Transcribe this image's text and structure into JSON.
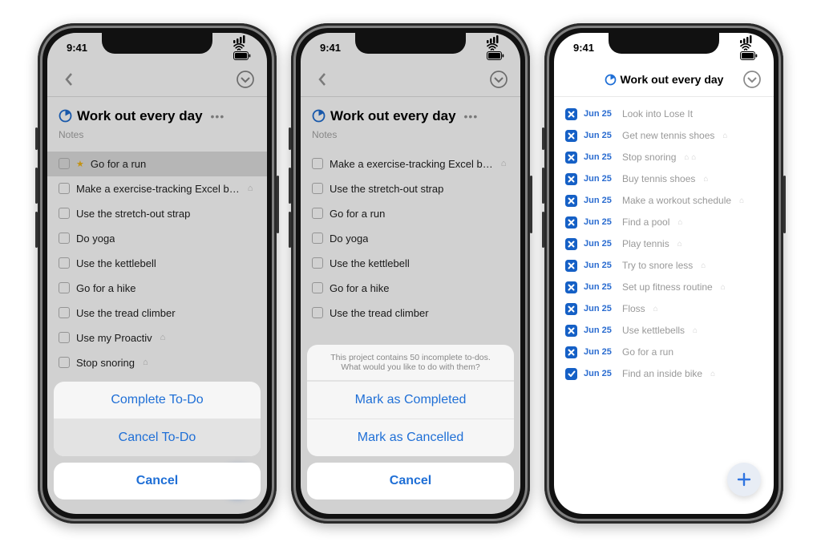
{
  "status": {
    "time": "9:41"
  },
  "phone1": {
    "title": "Work out every day",
    "notes_placeholder": "Notes",
    "todos": [
      {
        "label": "Go for a run",
        "starred": true,
        "selected": true
      },
      {
        "label": "Make a exercise-tracking Excel b…",
        "trail": true
      },
      {
        "label": "Use the stretch-out strap"
      },
      {
        "label": "Do yoga"
      },
      {
        "label": "Use the kettlebell"
      },
      {
        "label": "Go for a hike"
      },
      {
        "label": "Use the tread climber"
      },
      {
        "label": "Use my Proactiv",
        "trail": true
      },
      {
        "label": "Stop snoring",
        "trail": true
      }
    ],
    "sheet": {
      "complete": "Complete To-Do",
      "cancel_todo": "Cancel To-Do",
      "cancel": "Cancel"
    }
  },
  "phone2": {
    "title": "Work out every day",
    "notes_placeholder": "Notes",
    "todos": [
      {
        "label": "Make a exercise-tracking Excel b…",
        "trail": true
      },
      {
        "label": "Use the stretch-out strap"
      },
      {
        "label": "Go for a run"
      },
      {
        "label": "Do yoga"
      },
      {
        "label": "Use the kettlebell"
      },
      {
        "label": "Go for a hike"
      },
      {
        "label": "Use the tread climber"
      }
    ],
    "sheet": {
      "message": "This project contains 50 incomplete to-dos. What would you like to do with them?",
      "completed": "Mark as Completed",
      "cancelled": "Mark as Cancelled",
      "cancel": "Cancel"
    }
  },
  "phone3": {
    "title": "Work out every day",
    "rows": [
      {
        "date": "Jun 25",
        "label": "Look into Lose It",
        "cancelled": true
      },
      {
        "date": "Jun 25",
        "label": "Get new tennis shoes",
        "trail": true,
        "cancelled": true
      },
      {
        "date": "Jun 25",
        "label": "Stop snoring",
        "trail2": true,
        "cancelled": true
      },
      {
        "date": "Jun 25",
        "label": "Buy tennis shoes",
        "trail": true,
        "cancelled": true
      },
      {
        "date": "Jun 25",
        "label": "Make a workout schedule",
        "trail": true,
        "cancelled": true
      },
      {
        "date": "Jun 25",
        "label": "Find a pool",
        "trail": true,
        "cancelled": true
      },
      {
        "date": "Jun 25",
        "label": "Play tennis",
        "trail": true,
        "cancelled": true
      },
      {
        "date": "Jun 25",
        "label": "Try to snore less",
        "trail": true,
        "cancelled": true
      },
      {
        "date": "Jun 25",
        "label": "Set up fitness routine",
        "trail": true,
        "cancelled": true
      },
      {
        "date": "Jun 25",
        "label": "Floss",
        "trail": true,
        "cancelled": true
      },
      {
        "date": "Jun 25",
        "label": "Use kettlebells",
        "trail": true,
        "cancelled": true
      },
      {
        "date": "Jun 25",
        "label": "Go for a run",
        "cancelled": true
      },
      {
        "date": "Jun 25",
        "label": "Find an inside bike",
        "trail": true,
        "completed": true
      }
    ]
  }
}
